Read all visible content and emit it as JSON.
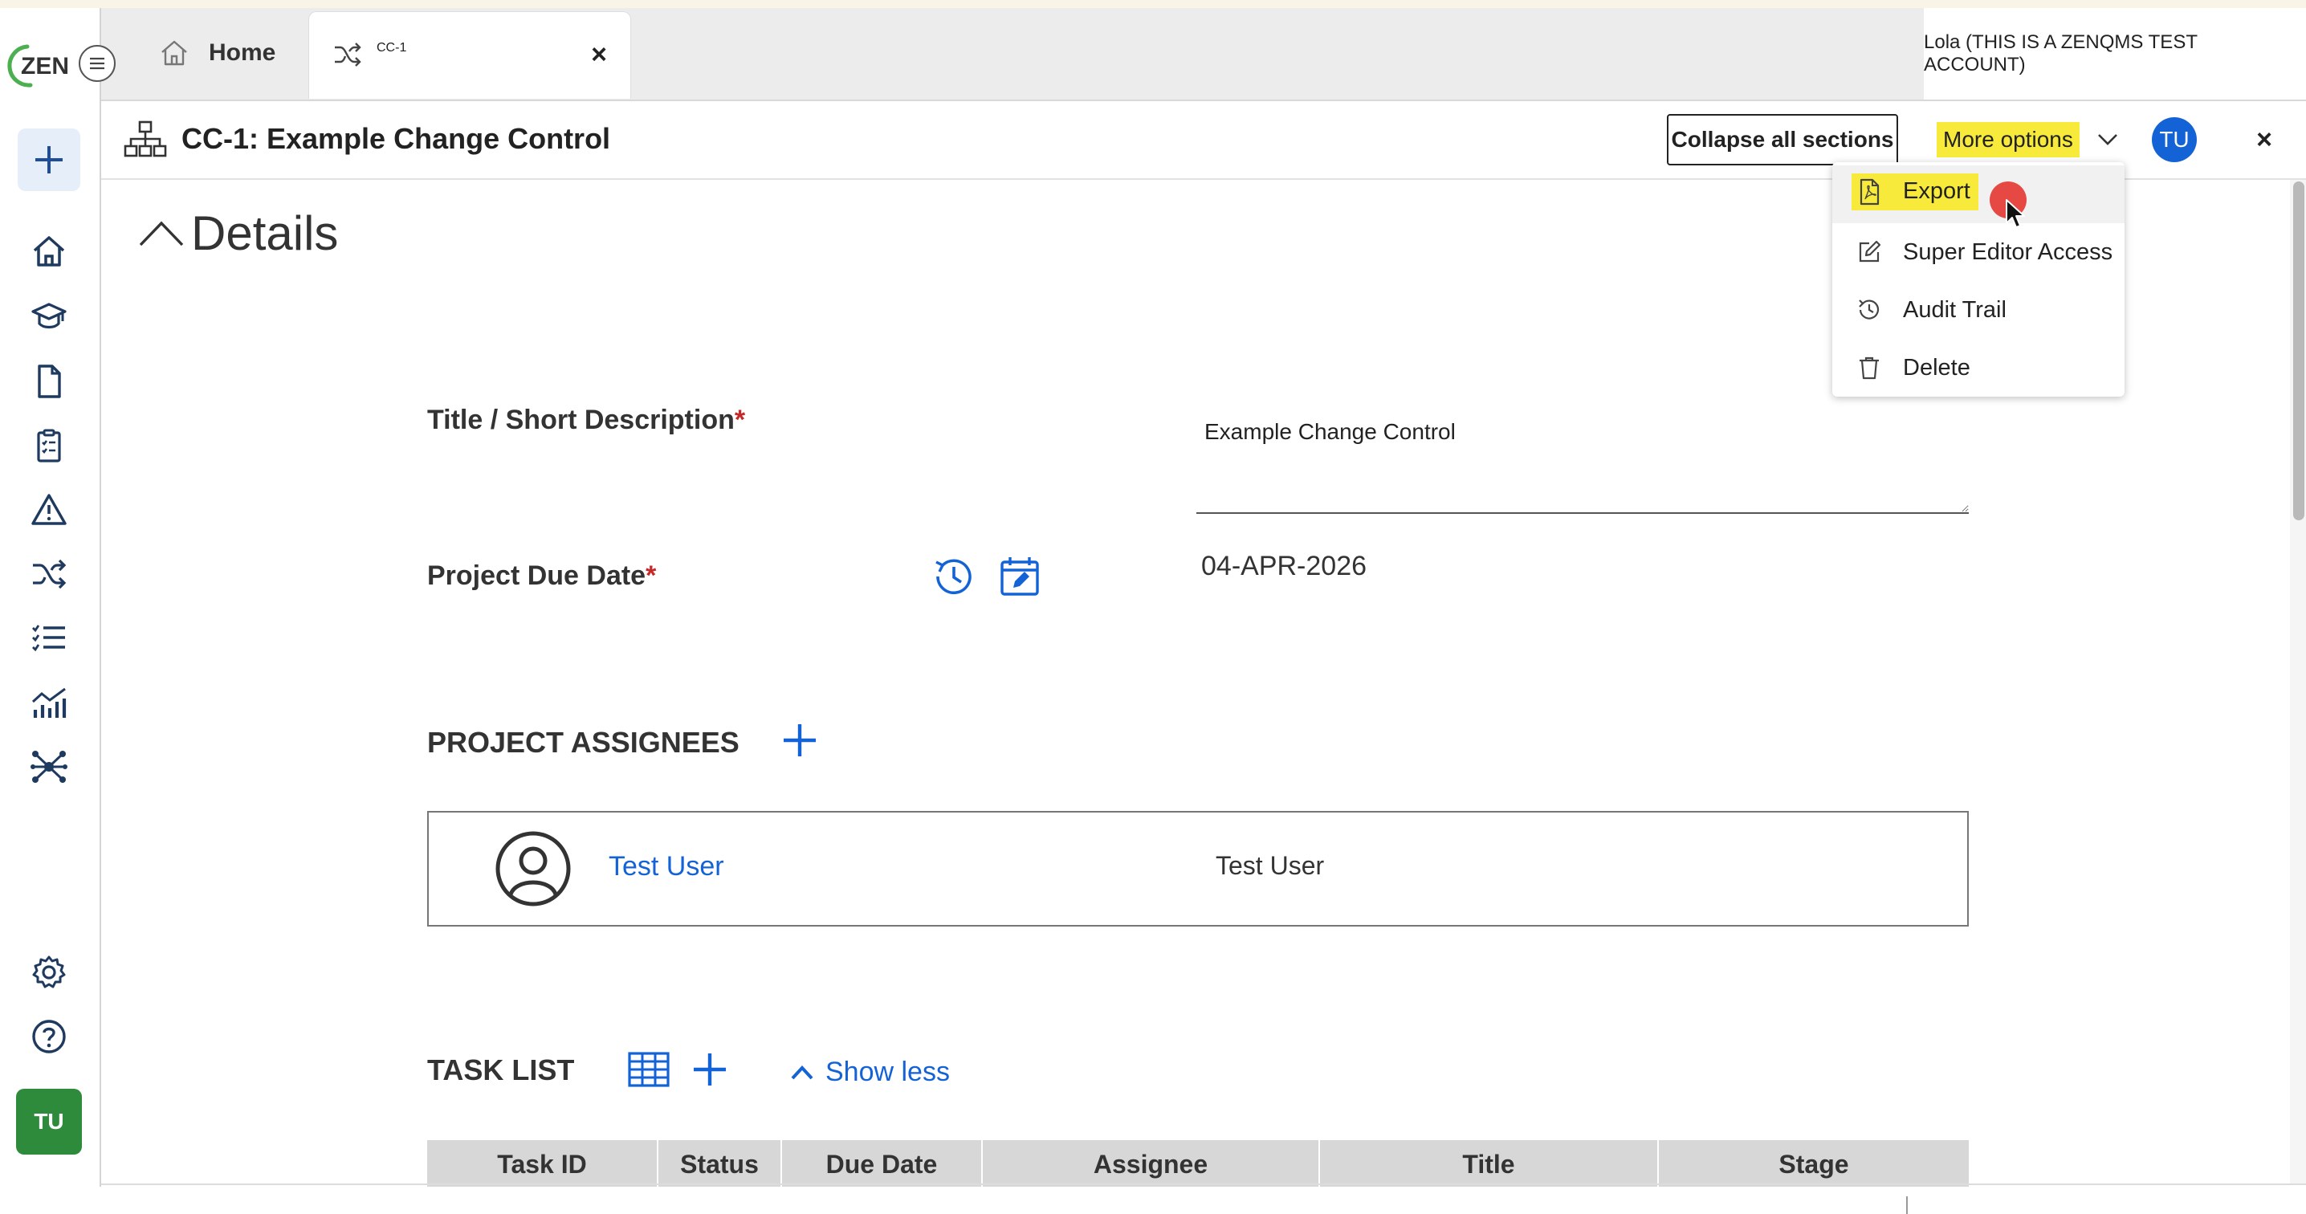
{
  "tabs": {
    "home_label": "Home",
    "active_label": "CC-1",
    "close_label": "×"
  },
  "logo_text": "ZEN",
  "tenant_label": "Lola (THIS IS A ZENQMS TEST ACCOUNT)",
  "header": {
    "record_title": "CC-1: Example Change Control",
    "collapse_label": "Collapse all sections",
    "more_options_label": "More options",
    "avatar_initials": "TU",
    "close_label": "×"
  },
  "more_options_menu": {
    "items": [
      {
        "label": "Export",
        "icon": "pdf-file-icon"
      },
      {
        "label": "Super Editor Access",
        "icon": "edit-icon"
      },
      {
        "label": "Audit Trail",
        "icon": "history-icon"
      },
      {
        "label": "Delete",
        "icon": "trash-icon"
      }
    ]
  },
  "details": {
    "section_title": "Details",
    "title_label": "Title / Short Description",
    "title_value": "Example Change Control",
    "due_date_label": "Project Due Date",
    "due_date_value": "04-APR-2026",
    "required_marker": "*"
  },
  "assignees": {
    "heading": "PROJECT ASSIGNEES",
    "items": [
      {
        "name": "Test User",
        "display": "Test User"
      }
    ]
  },
  "task_list": {
    "heading": "TASK LIST",
    "toggle_label": "Show less",
    "columns": [
      "Task ID",
      "Status",
      "Due Date",
      "Assignee",
      "Title",
      "Stage"
    ]
  },
  "sidebar": {
    "user_initials": "TU",
    "icons": [
      "home-icon",
      "training-icon",
      "document-icon",
      "checklist-icon",
      "warning-icon",
      "change-control-icon",
      "task-list-icon",
      "analytics-icon",
      "network-icon",
      "gear-icon",
      "help-icon"
    ]
  },
  "colors": {
    "accent_blue": "#1463d6",
    "highlight_yellow": "#f7ea3a",
    "user_green": "#2e8b3c",
    "required_red": "#c62828"
  }
}
